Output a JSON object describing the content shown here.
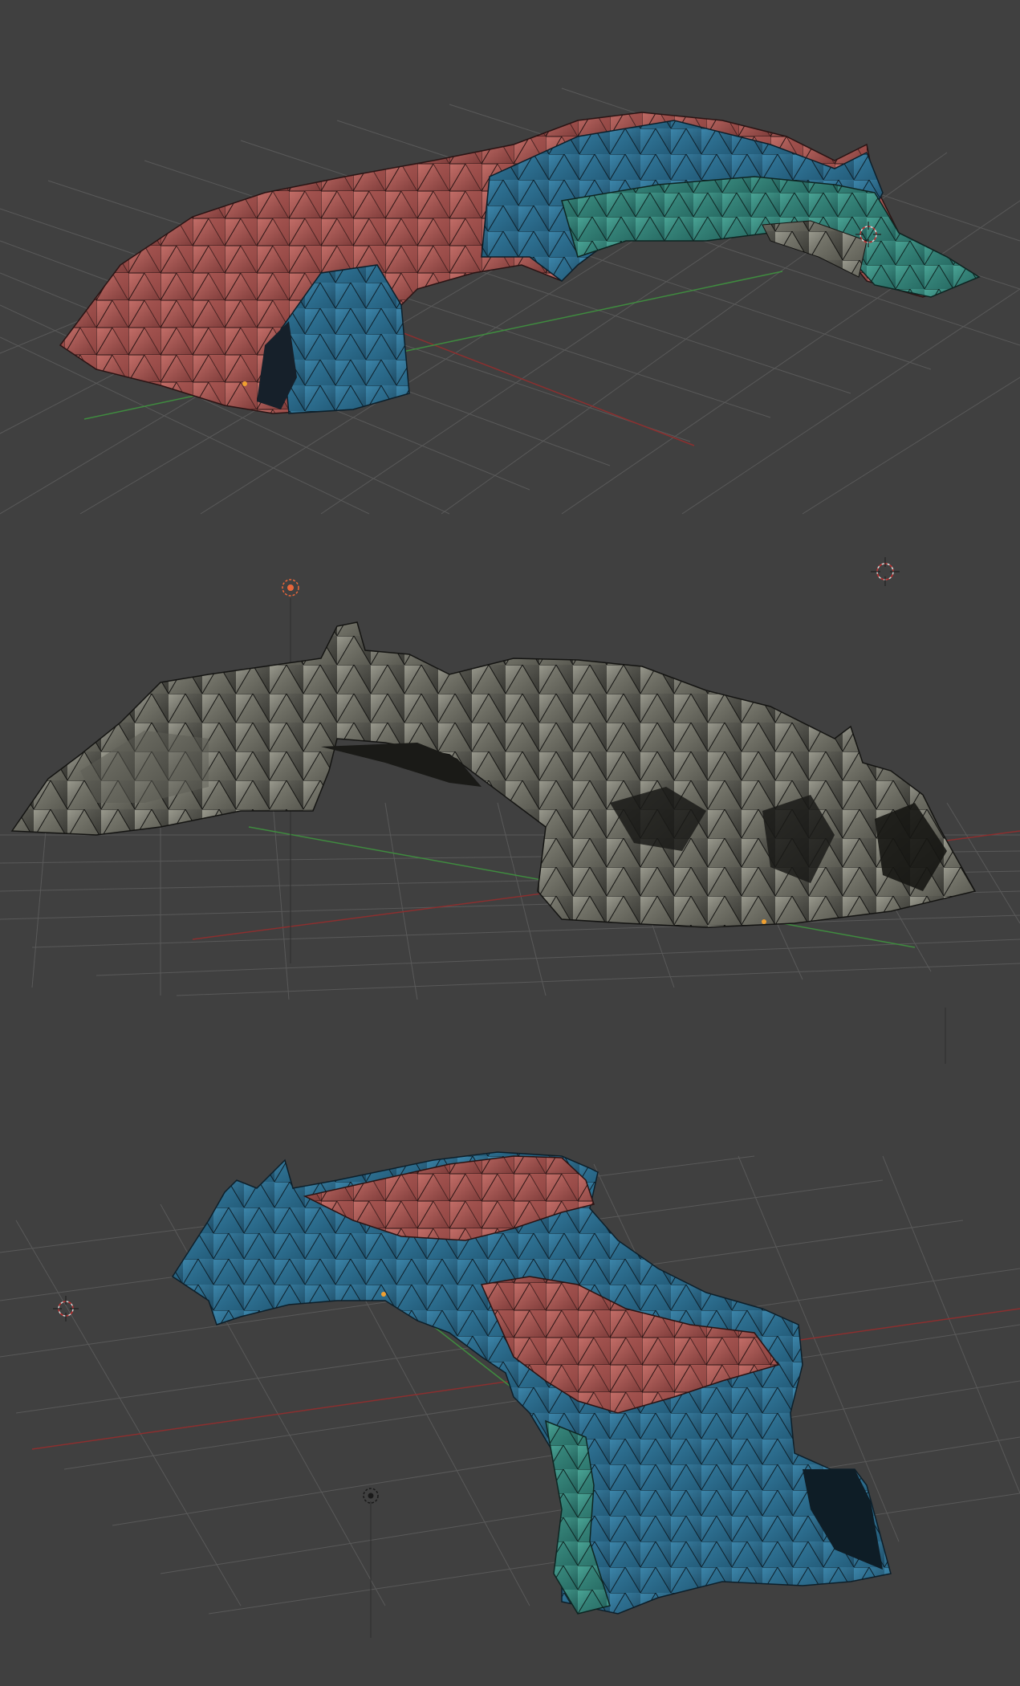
{
  "app": {
    "name": ""
  },
  "theme": {
    "background": "#404040",
    "grid": "#5a5a5a",
    "axis_x": "#8b2f2f",
    "axis_y": "#3f8b3f",
    "lamp": "#e8663a",
    "origin_dot": "#f0a030",
    "rock_red": "#b05a55",
    "rock_blue": "#2e6e8e",
    "rock_teal": "#3a8a80",
    "rock_gray": "#7a7a70",
    "edge": "#1a1a1a"
  },
  "viewports": [
    {
      "id": "top",
      "object": "rock-arch-mesh",
      "shading": "textured-wireframe",
      "palette": [
        "red",
        "blue",
        "teal"
      ]
    },
    {
      "id": "middle",
      "object": "rock-arch-mesh",
      "shading": "textured-wireframe",
      "palette": [
        "gray"
      ]
    },
    {
      "id": "bottom",
      "object": "rock-arch-mesh",
      "shading": "textured-wireframe",
      "palette": [
        "blue",
        "red",
        "teal"
      ]
    }
  ],
  "icons": [
    "3d-cursor-icon",
    "lamp-icon",
    "camera-icon",
    "origin-dot-icon"
  ]
}
